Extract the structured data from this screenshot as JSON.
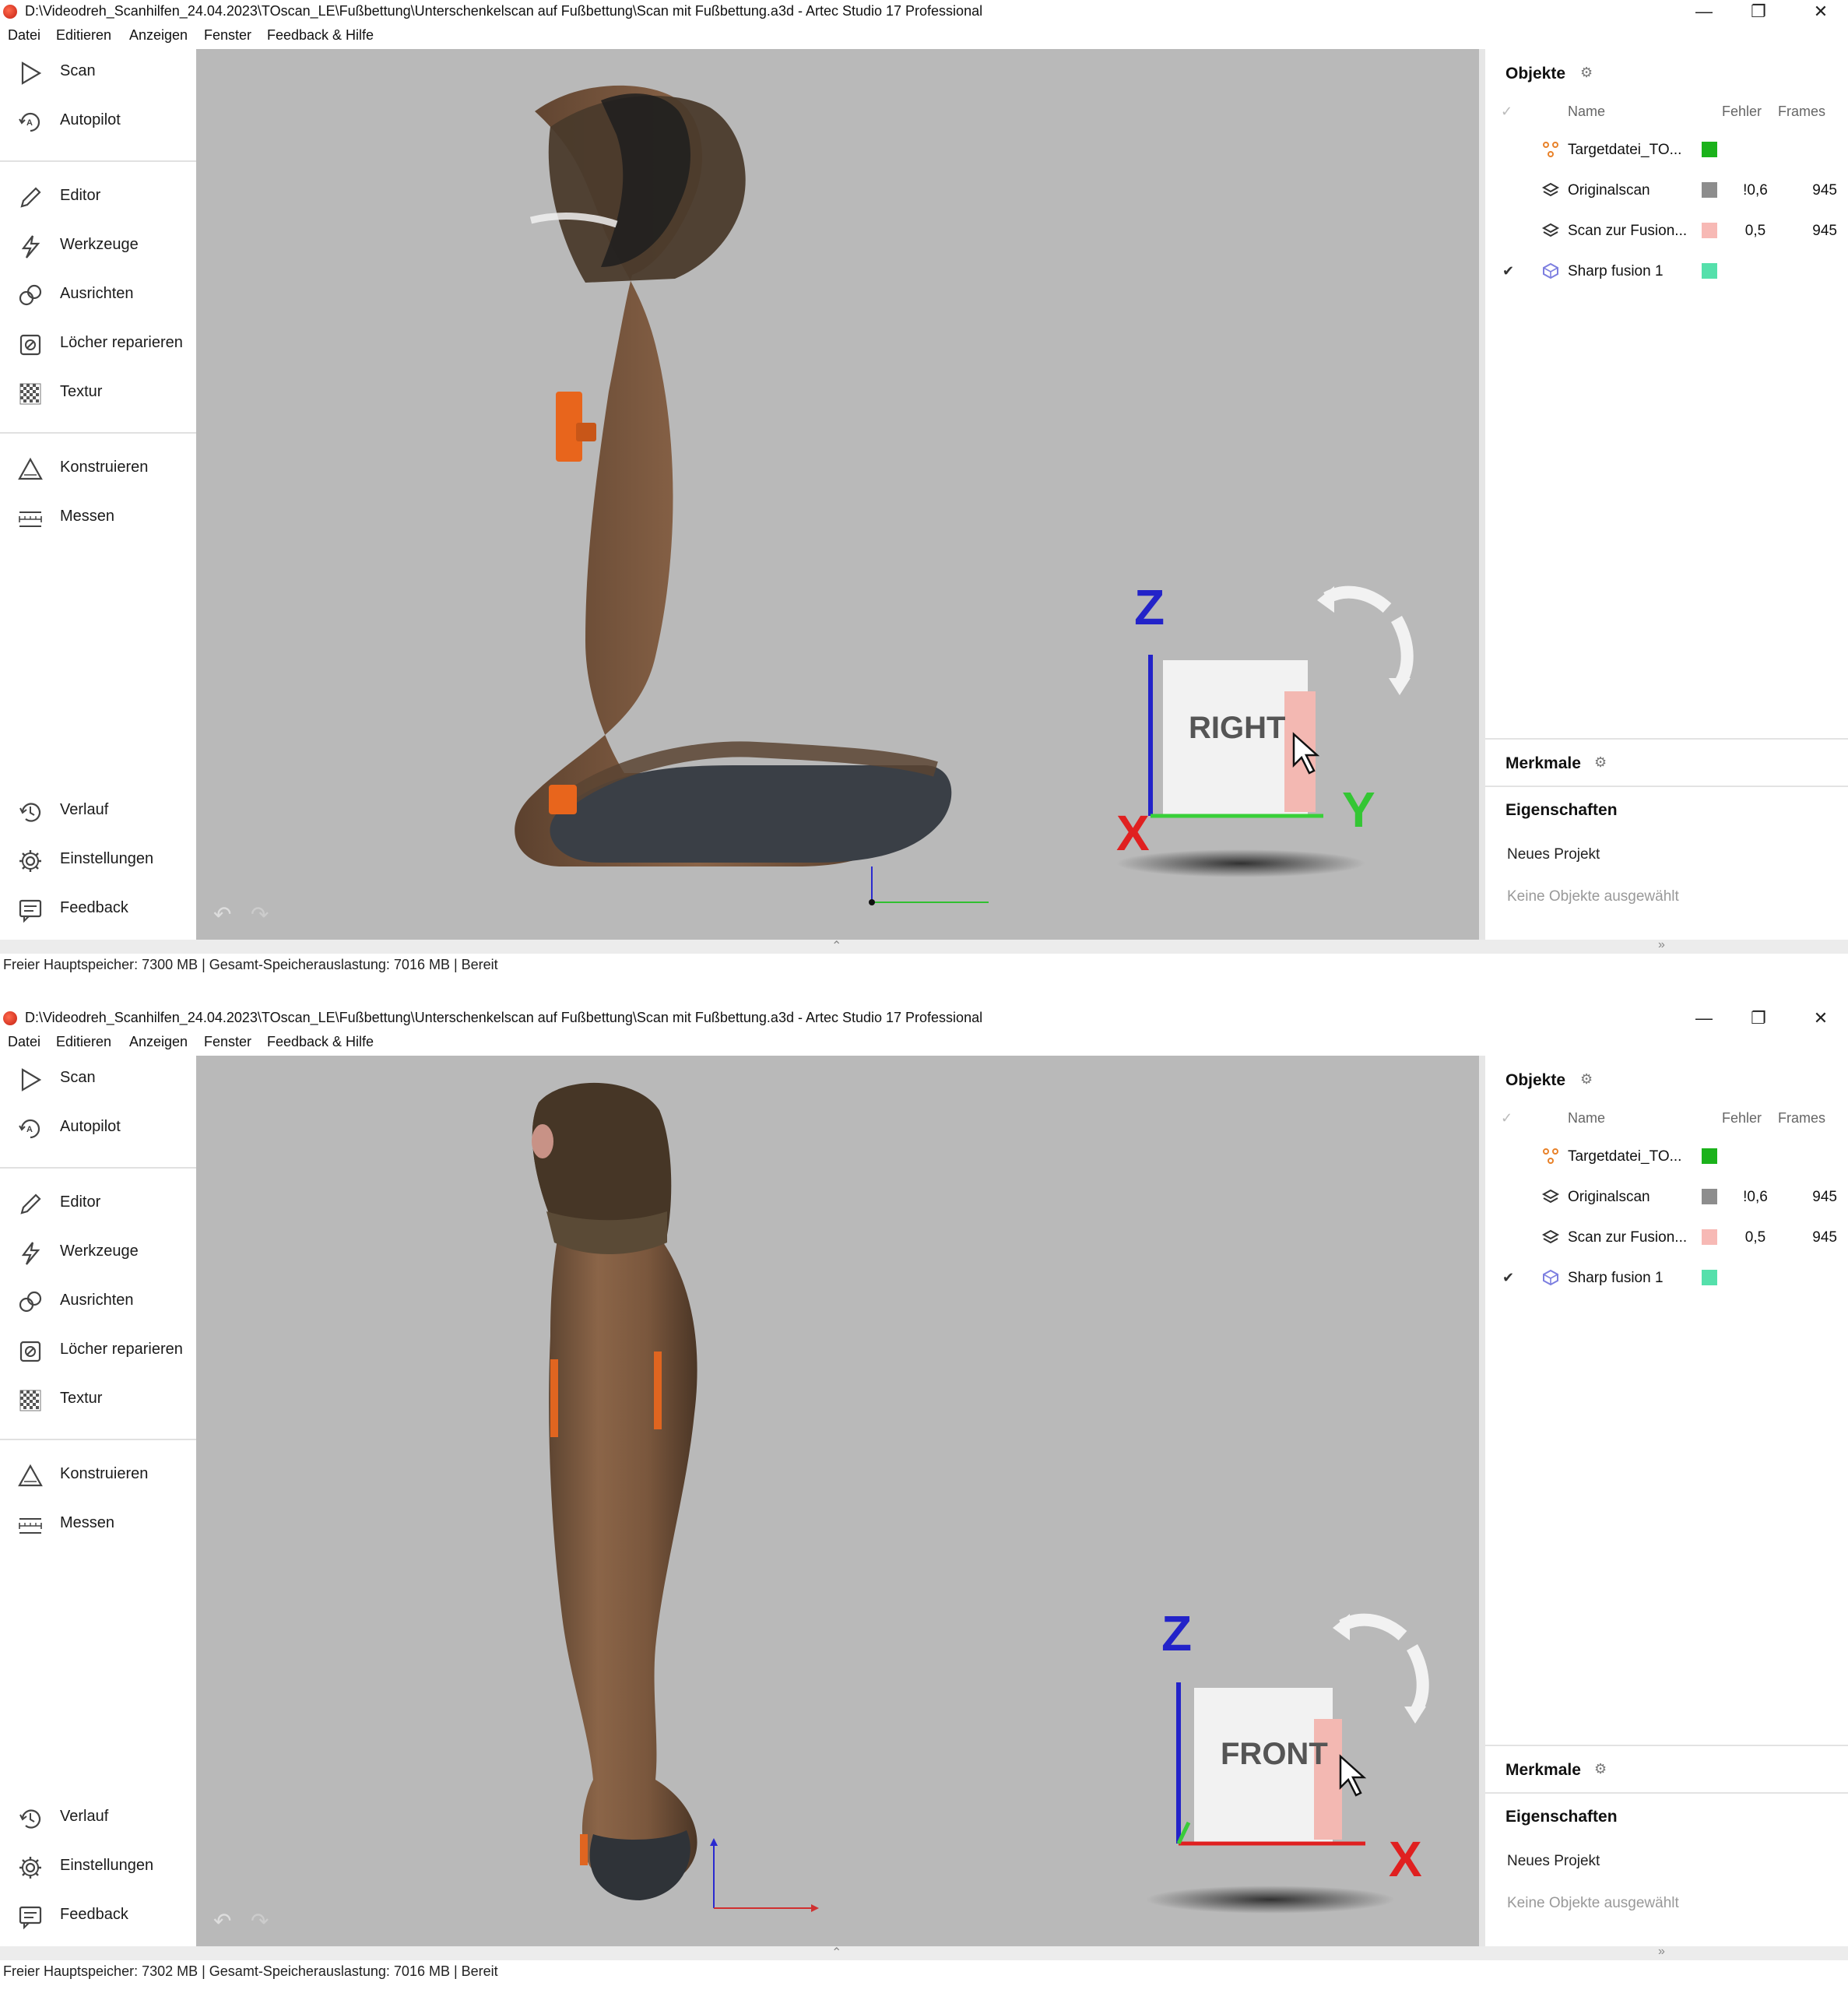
{
  "windows": [
    {
      "title": "D:\\Videodreh_Scanhilfen_24.04.2023\\TOscan_LE\\Fußbettung\\Unterschenkelscan auf Fußbettung\\Scan mit Fußbettung.a3d - Artec Studio 17 Professional",
      "menu": [
        "Datei",
        "Editieren",
        "Anzeigen",
        "Fenster",
        "Feedback & Hilfe"
      ],
      "sidebar": {
        "scan": "Scan",
        "autopilot": "Autopilot",
        "editor": "Editor",
        "werkzeuge": "Werkzeuge",
        "ausrichten": "Ausrichten",
        "loecher": "Löcher reparieren",
        "textur": "Textur",
        "konstruieren": "Konstruieren",
        "messen": "Messen",
        "verlauf": "Verlauf",
        "einstellungen": "Einstellungen",
        "feedback": "Feedback",
        "collapse": "«"
      },
      "viewcube": {
        "face": "RIGHT",
        "axis_z": "Z",
        "axis_x": "X",
        "axis_y": "Y"
      },
      "objects_panel": {
        "title": "Objekte",
        "col_name": "Name",
        "col_error": "Fehler",
        "col_frames": "Frames",
        "rows": [
          {
            "check": "",
            "icon": "target-icon",
            "name": "Targetdatei_TO...",
            "color": "#1bb21b",
            "error": "",
            "frames": ""
          },
          {
            "check": "",
            "icon": "layers-icon",
            "name": "Originalscan",
            "color": "#8d8d8d",
            "error": "!0,6",
            "frames": "945"
          },
          {
            "check": "",
            "icon": "layers-icon",
            "name": "Scan zur Fusion...",
            "color": "#f7b9b5",
            "error": "0,5",
            "frames": "945"
          },
          {
            "check": "✔",
            "icon": "mesh-cube-icon",
            "name": "Sharp fusion 1",
            "color": "#55e0ab",
            "error": "",
            "frames": ""
          }
        ]
      },
      "merkmale": "Merkmale",
      "eigenschaften": "Eigenschaften",
      "project": "Neues Projekt",
      "no_selection": "Keine Objekte ausgewählt",
      "status": "Freier Hauptspeicher: 7300 MB  |  Gesamt-Speicherauslastung: 7016 MB  |   Bereit"
    },
    {
      "title": "D:\\Videodreh_Scanhilfen_24.04.2023\\TOscan_LE\\Fußbettung\\Unterschenkelscan auf Fußbettung\\Scan mit Fußbettung.a3d - Artec Studio 17 Professional",
      "menu": [
        "Datei",
        "Editieren",
        "Anzeigen",
        "Fenster",
        "Feedback & Hilfe"
      ],
      "sidebar": {
        "scan": "Scan",
        "autopilot": "Autopilot",
        "editor": "Editor",
        "werkzeuge": "Werkzeuge",
        "ausrichten": "Ausrichten",
        "loecher": "Löcher reparieren",
        "textur": "Textur",
        "konstruieren": "Konstruieren",
        "messen": "Messen",
        "verlauf": "Verlauf",
        "einstellungen": "Einstellungen",
        "feedback": "Feedback",
        "collapse": "«"
      },
      "viewcube": {
        "face": "FRONT",
        "axis_z": "Z",
        "axis_x": "X",
        "axis_y": ""
      },
      "objects_panel": {
        "title": "Objekte",
        "col_name": "Name",
        "col_error": "Fehler",
        "col_frames": "Frames",
        "rows": [
          {
            "check": "",
            "icon": "target-icon",
            "name": "Targetdatei_TO...",
            "color": "#1bb21b",
            "error": "",
            "frames": ""
          },
          {
            "check": "",
            "icon": "layers-icon",
            "name": "Originalscan",
            "color": "#8d8d8d",
            "error": "!0,6",
            "frames": "945"
          },
          {
            "check": "",
            "icon": "layers-icon",
            "name": "Scan zur Fusion...",
            "color": "#f7b9b5",
            "error": "0,5",
            "frames": "945"
          },
          {
            "check": "✔",
            "icon": "mesh-cube-icon",
            "name": "Sharp fusion 1",
            "color": "#55e0ab",
            "error": "",
            "frames": ""
          }
        ]
      },
      "merkmale": "Merkmale",
      "eigenschaften": "Eigenschaften",
      "project": "Neues Projekt",
      "no_selection": "Keine Objekte ausgewählt",
      "status": "Freier Hauptspeicher: 7302 MB  |  Gesamt-Speicherauslastung: 7016 MB  |   Bereit"
    }
  ]
}
